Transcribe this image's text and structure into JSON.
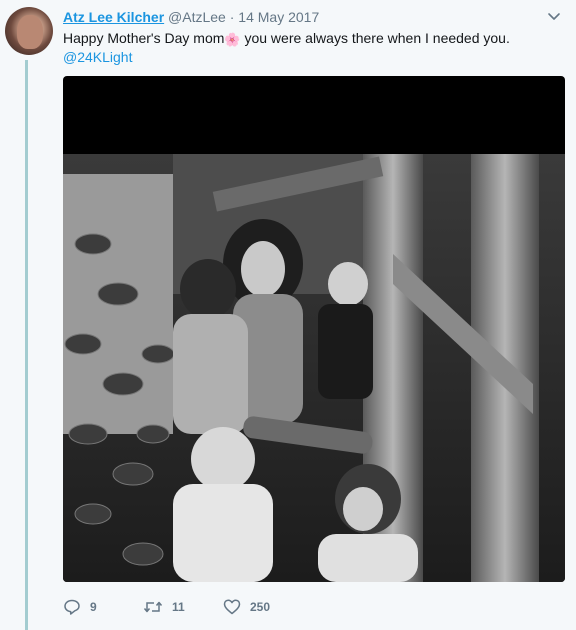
{
  "tweet": {
    "author_name": "Atz Lee Kilcher",
    "handle": "@AtzLee",
    "separator": "·",
    "date": "14 May 2017",
    "text_before_emoji": "Happy Mother's Day mom",
    "emoji": "🌸",
    "text_after_emoji": " you were always there when I needed you.",
    "mention": "@24KLight"
  },
  "actions": {
    "reply_count": "9",
    "retweet_count": "11",
    "like_count": "250"
  },
  "colors": {
    "link": "#1b95e0",
    "muted": "#657786",
    "thread_line": "#a3ccd0",
    "background": "#f5f8fa"
  },
  "icons": [
    "chevron-down-icon",
    "reply-icon",
    "retweet-icon",
    "heart-icon"
  ]
}
